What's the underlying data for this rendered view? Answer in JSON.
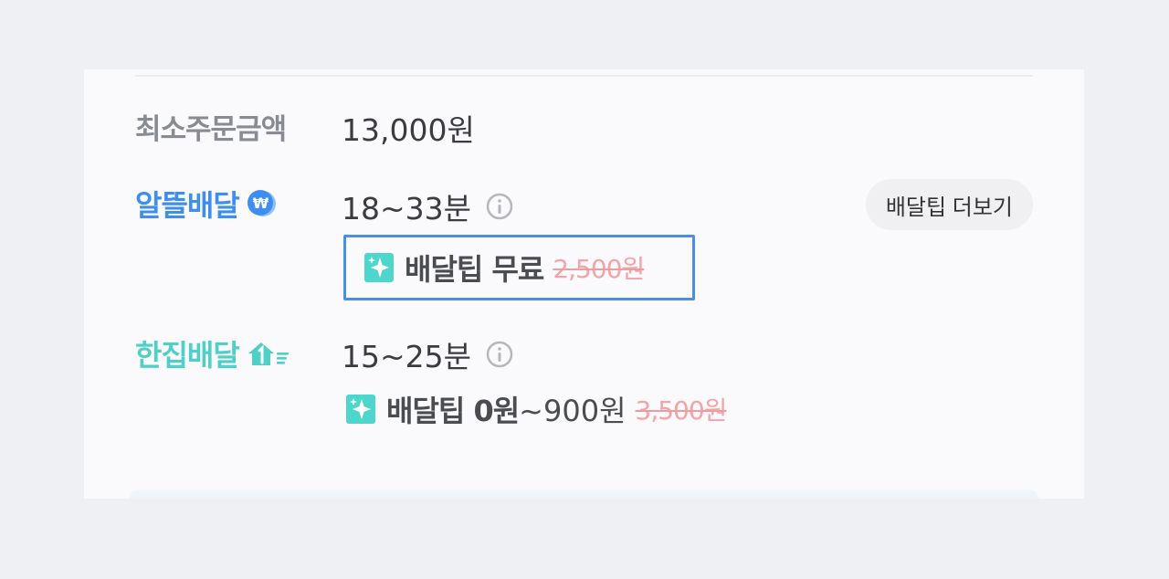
{
  "min_order": {
    "label": "최소주문금액",
    "value": "13,000원"
  },
  "saver_delivery": {
    "label": "알뜰배달",
    "time": "18~33분",
    "more_button": "배달팁 더보기",
    "tip_main": "배달팁 무료",
    "tip_original": "2,500원",
    "accent_color": "#3e8ef0"
  },
  "single_delivery": {
    "label": "한집배달",
    "time": "15~25분",
    "tip_main": "배달팁 0원",
    "tip_range": "~900원",
    "tip_original": "3,500원",
    "accent_color": "#4fcfc5"
  },
  "icons": {
    "saver": "won-coin-icon",
    "single": "house-fast-icon",
    "info": "info-icon",
    "sparkle": "sparkle-icon"
  }
}
